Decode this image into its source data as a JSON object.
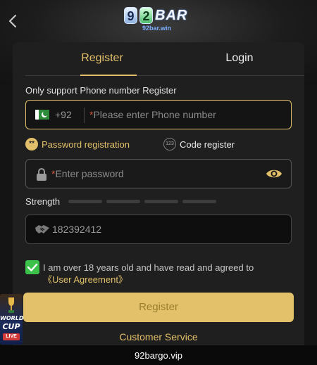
{
  "header": {
    "back_icon": "chevron-left-icon",
    "logo": {
      "digits": [
        "9",
        "2"
      ],
      "word": "BAR",
      "subtitle": "92bar.win"
    }
  },
  "tabs": [
    {
      "label": "Register",
      "active": true
    },
    {
      "label": "Login",
      "active": false
    }
  ],
  "form": {
    "notice": "Only support Phone number Register",
    "phone": {
      "country_code": "+92",
      "required_mark": "*",
      "placeholder": "Please enter Phone number",
      "value": ""
    },
    "registration_modes": [
      {
        "label": "Password registration",
        "icon": "password-dots-icon",
        "icon_text": "**",
        "selected": true
      },
      {
        "label": "Code register",
        "icon": "numeric-code-icon",
        "icon_text": "123",
        "selected": false
      }
    ],
    "password": {
      "required_mark": "*",
      "placeholder": "Enter password",
      "value": ""
    },
    "strength": {
      "label": "Strength",
      "levels": 4,
      "filled": 0
    },
    "invite_code": {
      "value": "182392412",
      "icon": "handshake-icon"
    },
    "agreement": {
      "checked": true,
      "text": "I am over 18 years old and have read and agreed to",
      "link": "《User Agreement》"
    },
    "submit_label": "Register"
  },
  "customer_service": "Customer Service",
  "footer": {
    "url": "92bargo.vip"
  },
  "promo_badge": {
    "line1": "WORLD",
    "line2": "CUP",
    "tag": "LIVE"
  },
  "colors": {
    "accent": "#e2c06a",
    "background": "#141414",
    "card": "#1f1f1f",
    "check_green": "#3cc24a"
  }
}
